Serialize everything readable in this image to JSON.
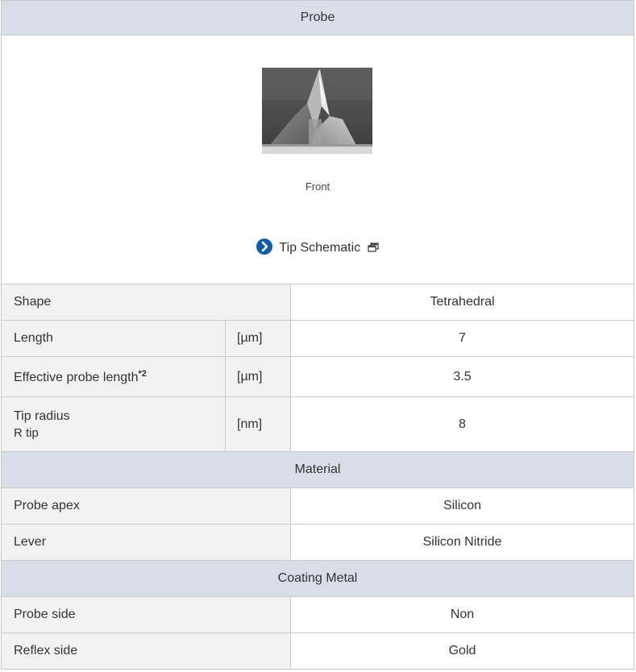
{
  "probe_header": "Probe",
  "image": {
    "caption": "Front",
    "tip_link": "Tip Schematic",
    "icons": [
      "chevron-right-circle-icon",
      "new-window-icon"
    ]
  },
  "rows": {
    "shape": {
      "label": "Shape",
      "value": "Tetrahedral"
    },
    "length": {
      "label": "Length",
      "unit": "[µm]",
      "value": "7"
    },
    "effective": {
      "label": "Effective probe length",
      "note": "*2",
      "unit": "[µm]",
      "value": "3.5"
    },
    "tip_radius": {
      "label": "Tip radius",
      "sublabel": "R tip",
      "unit": "[nm]",
      "value": "8"
    }
  },
  "material": {
    "header": "Material",
    "probe_apex": {
      "label": "Probe apex",
      "value": "Silicon"
    },
    "lever": {
      "label": "Lever",
      "value": "Silicon Nitride"
    }
  },
  "coating": {
    "header": "Coating Metal",
    "probe_side": {
      "label": "Probe side",
      "value": "Non"
    },
    "reflex_side": {
      "label": "Reflex side",
      "value": "Gold"
    }
  },
  "colors": {
    "header_bg": "#d9dde8",
    "label_bg": "#f2f2f2",
    "border": "#c9c9c9",
    "link_icon": "#0f5ca6"
  }
}
